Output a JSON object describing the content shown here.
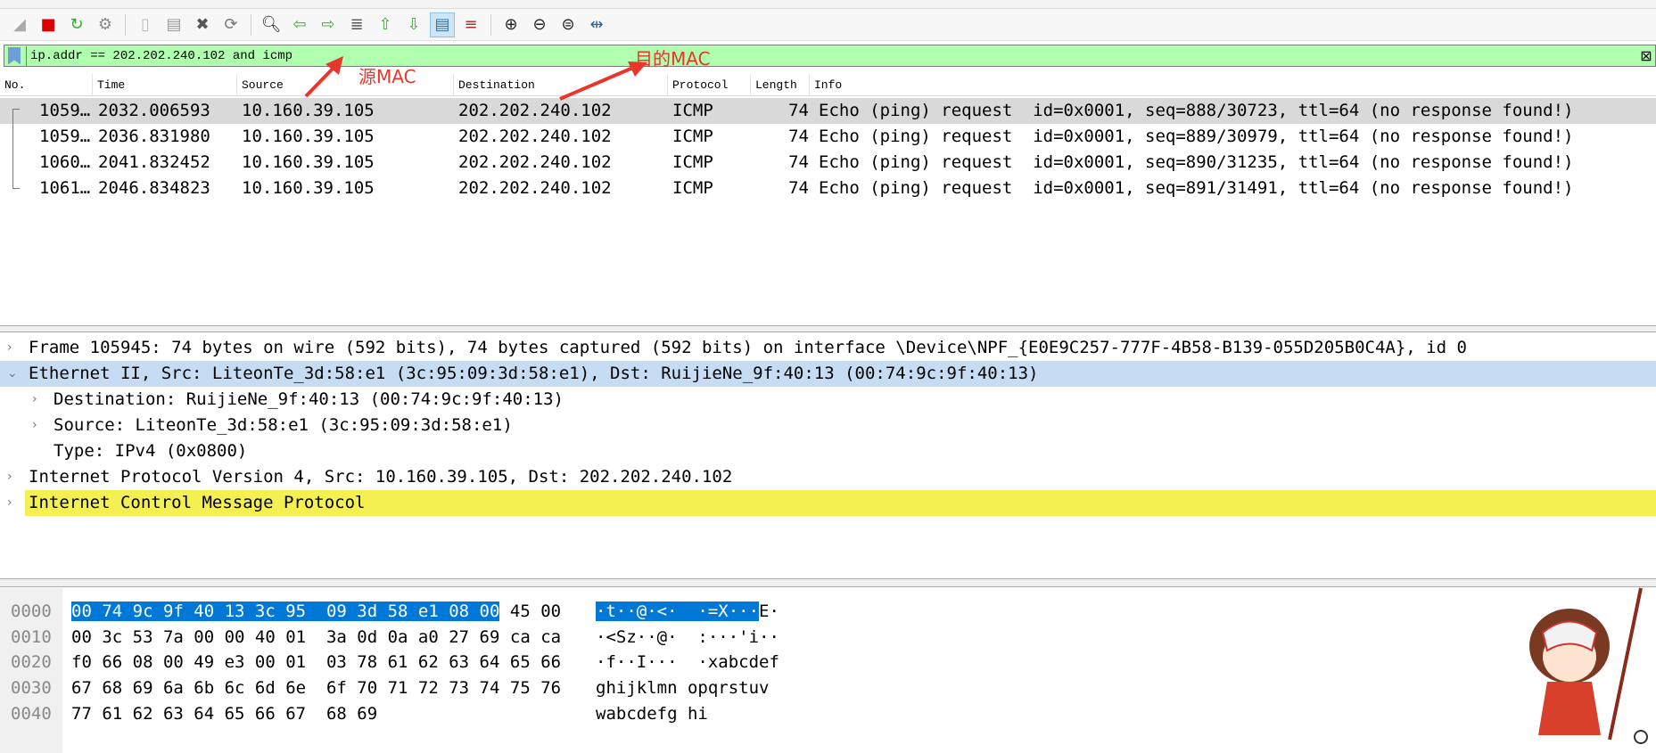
{
  "toolbar": {
    "icons": [
      "shark-fin-start-icon",
      "stop-capture-icon",
      "restart-capture-icon",
      "capture-options-icon",
      "open-file-icon",
      "save-file-icon",
      "close-file-icon",
      "reload-file-icon",
      "find-packet-icon",
      "go-back-icon",
      "go-forward-icon",
      "go-to-packet-icon",
      "first-packet-icon",
      "last-packet-icon",
      "auto-scroll-icon",
      "colorize-icon",
      "zoom-in-icon",
      "zoom-out-icon",
      "zoom-normal-icon",
      "resize-columns-icon"
    ]
  },
  "filter": {
    "value": "ip.addr == 202.202.240.102 and icmp",
    "bg_color": "#afffaf"
  },
  "annotations": {
    "source_mac": "源MAC",
    "dest_mac": "目的MAC",
    "color": "#e8362a"
  },
  "packet_list": {
    "columns": [
      "No.",
      "Time",
      "Source",
      "Destination",
      "Protocol",
      "Length",
      "Info"
    ],
    "rows": [
      {
        "no": "1059…",
        "time": "2032.006593",
        "source": "10.160.39.105",
        "destination": "202.202.240.102",
        "protocol": "ICMP",
        "length": "74",
        "info": "Echo (ping) request  id=0x0001, seq=888/30723, ttl=64 (no response found!)"
      },
      {
        "no": "1059…",
        "time": "2036.831980",
        "source": "10.160.39.105",
        "destination": "202.202.240.102",
        "protocol": "ICMP",
        "length": "74",
        "info": "Echo (ping) request  id=0x0001, seq=889/30979, ttl=64 (no response found!)"
      },
      {
        "no": "1060…",
        "time": "2041.832452",
        "source": "10.160.39.105",
        "destination": "202.202.240.102",
        "protocol": "ICMP",
        "length": "74",
        "info": "Echo (ping) request  id=0x0001, seq=890/31235, ttl=64 (no response found!)"
      },
      {
        "no": "1061…",
        "time": "2046.834823",
        "source": "10.160.39.105",
        "destination": "202.202.240.102",
        "protocol": "ICMP",
        "length": "74",
        "info": "Echo (ping) request  id=0x0001, seq=891/31491, ttl=64 (no response found!)"
      }
    ]
  },
  "details": [
    {
      "text": "Frame 105945: 74 bytes on wire (592 bits), 74 bytes captured (592 bits) on interface \\Device\\NPF_{E0E9C257-777F-4B58-B139-055D205B0C4A}, id 0",
      "expanded": false
    },
    {
      "text": "Ethernet II, Src: LiteonTe_3d:58:e1 (3c:95:09:3d:58:e1), Dst: RuijieNe_9f:40:13 (00:74:9c:9f:40:13)",
      "expanded": true
    },
    {
      "text": "Destination: RuijieNe_9f:40:13 (00:74:9c:9f:40:13)",
      "expanded": false
    },
    {
      "text": "Source: LiteonTe_3d:58:e1 (3c:95:09:3d:58:e1)",
      "expanded": false
    },
    {
      "text": "Type: IPv4 (0x0800)"
    },
    {
      "text": "Internet Protocol Version 4, Src: 10.160.39.105, Dst: 202.202.240.102",
      "expanded": false
    },
    {
      "text": "Internet Control Message Protocol",
      "expanded": false
    }
  ],
  "hex": [
    {
      "offset": "0000",
      "hl_hex": "00 74 9c 9f 40 13 3c 95  09 3d 58 e1 08 00",
      "hex": " 45 00",
      "hl_ascii": "·t··@·<·  ·=X···",
      "ascii": "E·"
    },
    {
      "offset": "0010",
      "hex": "00 3c 53 7a 00 00 40 01  3a 0d 0a a0 27 69 ca ca",
      "ascii": "·<Sz··@·  :···'i··"
    },
    {
      "offset": "0020",
      "hex": "f0 66 08 00 49 e3 00 01  03 78 61 62 63 64 65 66",
      "ascii": "·f··I···  ·xabcdef"
    },
    {
      "offset": "0030",
      "hex": "67 68 69 6a 6b 6c 6d 6e  6f 70 71 72 73 74 75 76",
      "ascii": "ghijklmn opqrstuv"
    },
    {
      "offset": "0040",
      "hex": "77 61 62 63 64 65 66 67  68 69",
      "ascii": "wabcdefg hi"
    }
  ],
  "colors": {
    "selected_row": "#d9d9d9",
    "ethernet_highlight": "#c5dcf2",
    "icmp_highlight": "#f4f052",
    "hex_selection": "#0078d7"
  }
}
